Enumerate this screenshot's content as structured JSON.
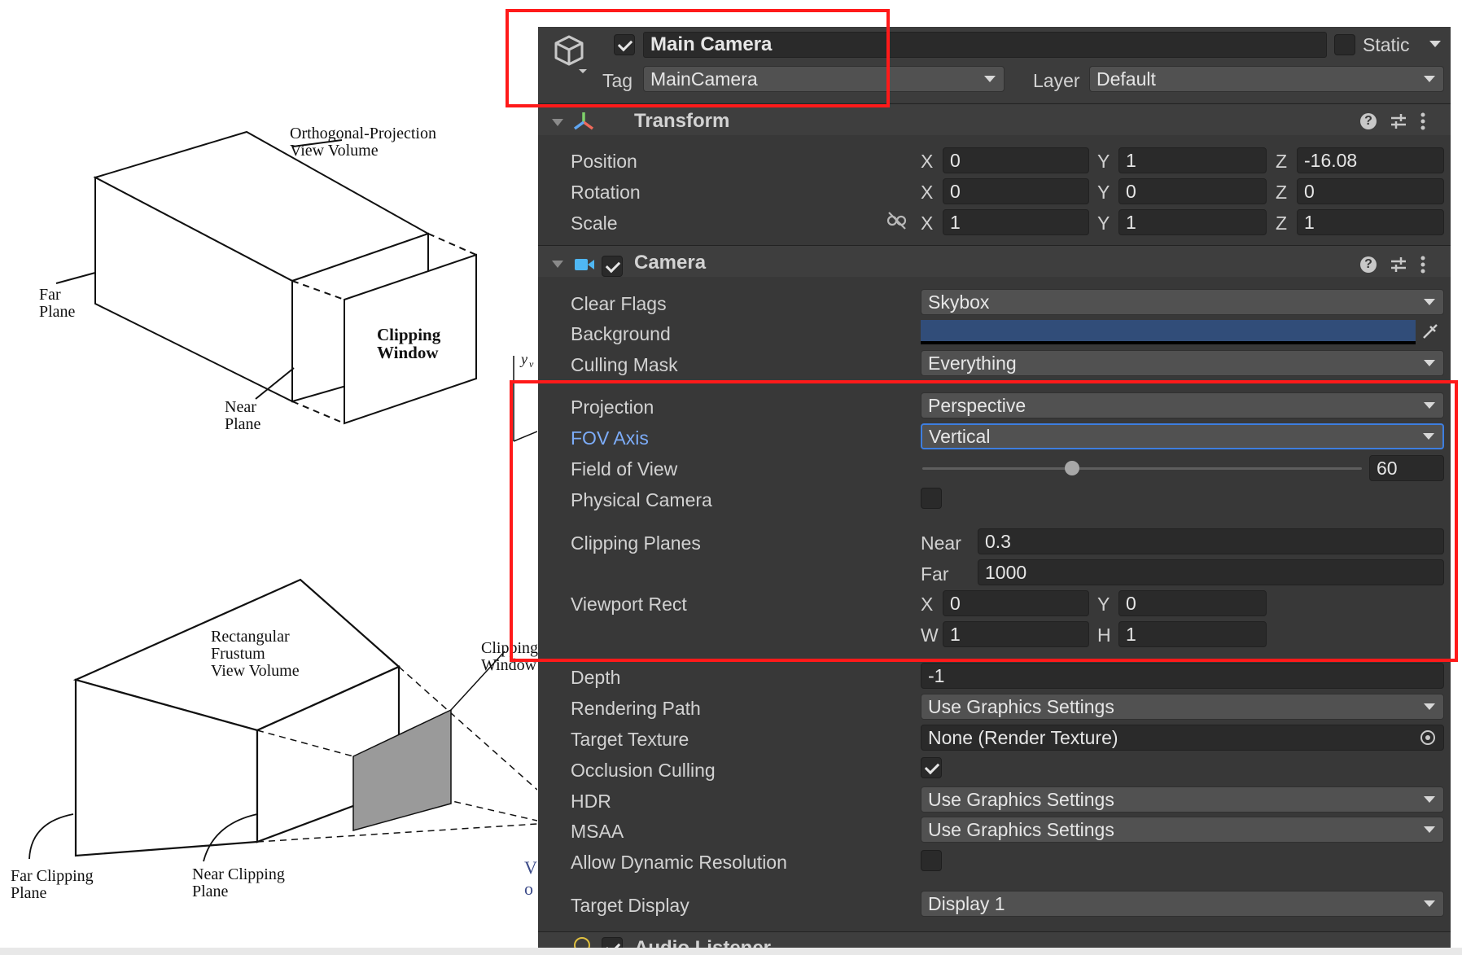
{
  "left_figures": {
    "top": {
      "title": "Orthogonal-Projection\nView Volume",
      "far_plane": "Far\nPlane",
      "near_plane": "Near\nPlane",
      "clipping_window": "Clipping\nWindow",
      "yv_label": "y",
      "yv_sub": "v"
    },
    "bottom": {
      "title": "Rectangular\nFrustum\nView Volume",
      "clipping_window": "Clipping\nWindow",
      "far_clipping_plane": "Far Clipping\nPlane",
      "near_clipping_plane": "Near Clipping\nPlane",
      "fragment_1": "V",
      "fragment_2": "o"
    }
  },
  "header": {
    "object_name": "Main Camera",
    "active_checked": true,
    "static_label": "Static",
    "static_checked": false,
    "tag_label": "Tag",
    "tag_value": "MainCamera",
    "layer_label": "Layer",
    "layer_value": "Default"
  },
  "transform": {
    "title": "Transform",
    "position": {
      "label": "Position",
      "x": "0",
      "y": "1",
      "z": "-16.08"
    },
    "rotation": {
      "label": "Rotation",
      "x": "0",
      "y": "0",
      "z": "0"
    },
    "scale": {
      "label": "Scale",
      "x": "1",
      "y": "1",
      "z": "1"
    },
    "axis": {
      "x": "X",
      "y": "Y",
      "z": "Z",
      "w": "W",
      "h": "H"
    }
  },
  "camera": {
    "title": "Camera",
    "enabled": true,
    "clear_flags": {
      "label": "Clear Flags",
      "value": "Skybox"
    },
    "background": {
      "label": "Background",
      "color": "#314d79"
    },
    "culling_mask": {
      "label": "Culling Mask",
      "value": "Everything"
    },
    "projection": {
      "label": "Projection",
      "value": "Perspective"
    },
    "fov_axis": {
      "label": "FOV Axis",
      "value": "Vertical"
    },
    "field_of_view": {
      "label": "Field of View",
      "value": "60",
      "slider_fraction": 0.34
    },
    "physical_camera": {
      "label": "Physical Camera",
      "checked": false
    },
    "clipping_planes": {
      "label": "Clipping Planes",
      "near_label": "Near",
      "near": "0.3",
      "far_label": "Far",
      "far": "1000"
    },
    "viewport_rect": {
      "label": "Viewport Rect",
      "x": "0",
      "y": "0",
      "w": "1",
      "h": "1"
    },
    "depth": {
      "label": "Depth",
      "value": "-1"
    },
    "rendering_path": {
      "label": "Rendering Path",
      "value": "Use Graphics Settings"
    },
    "target_texture": {
      "label": "Target Texture",
      "value": "None (Render Texture)"
    },
    "occlusion_culling": {
      "label": "Occlusion Culling",
      "checked": true
    },
    "hdr": {
      "label": "HDR",
      "value": "Use Graphics Settings"
    },
    "msaa": {
      "label": "MSAA",
      "value": "Use Graphics Settings"
    },
    "allow_dynamic_resolution": {
      "label": "Allow Dynamic Resolution",
      "checked": false
    },
    "target_display": {
      "label": "Target Display",
      "value": "Display 1"
    }
  },
  "next_component": {
    "title": "Audio Listener"
  },
  "colors": {
    "highlight_box": "#ff1a1a",
    "fov_label": "#7cacf8",
    "inspector_bg": "#383838"
  }
}
